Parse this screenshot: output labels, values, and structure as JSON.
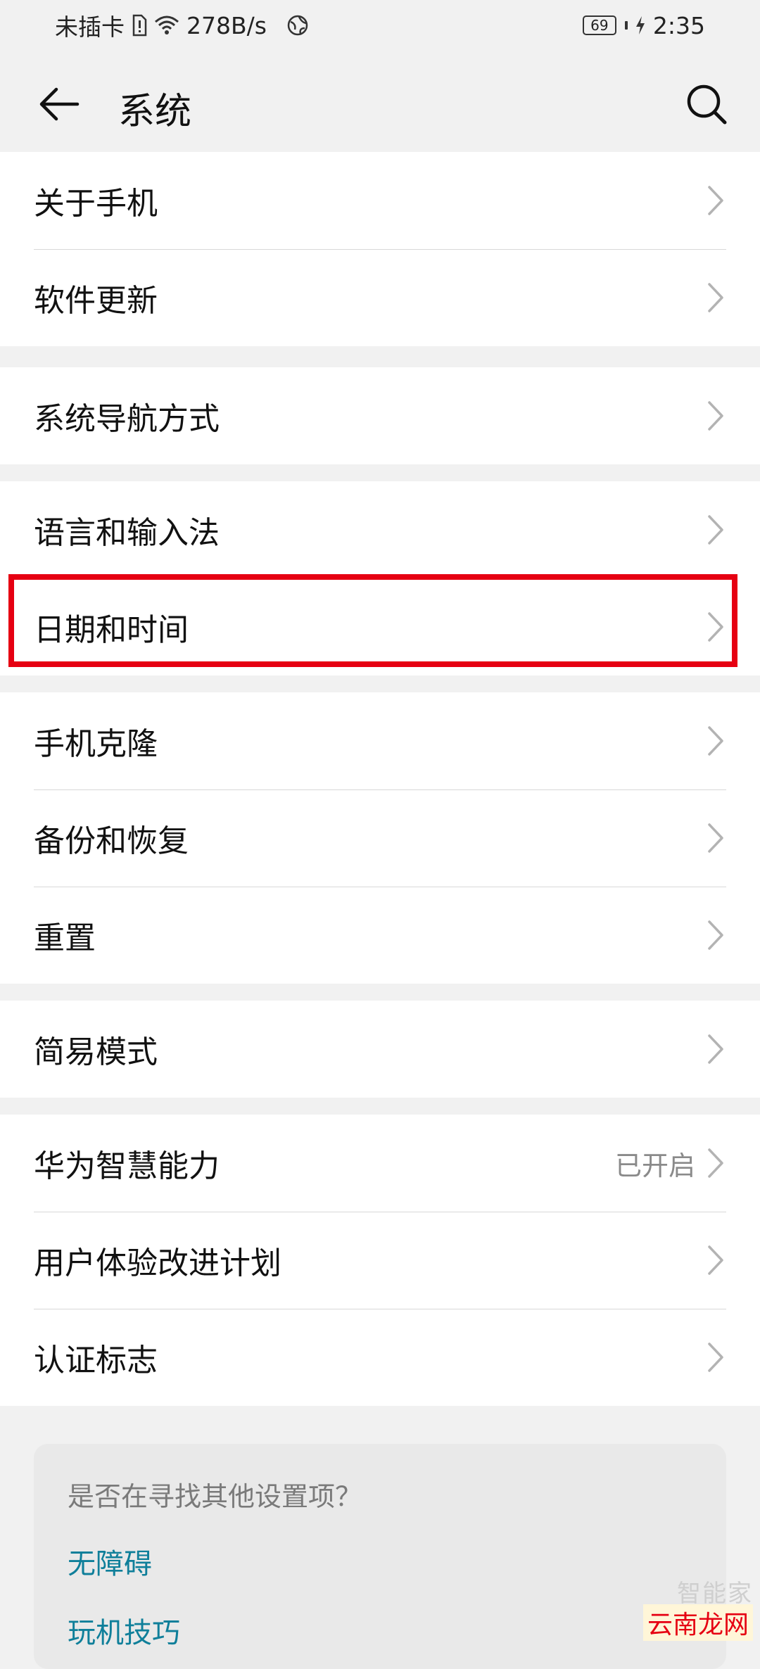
{
  "status_bar": {
    "carrier": "未插卡",
    "speed": "278B/s",
    "battery": "69",
    "time": "2:35"
  },
  "header": {
    "title": "系统"
  },
  "groups": [
    {
      "items": [
        {
          "label": "关于手机"
        },
        {
          "label": "软件更新"
        }
      ]
    },
    {
      "items": [
        {
          "label": "系统导航方式"
        }
      ]
    },
    {
      "items": [
        {
          "label": "语言和输入法"
        },
        {
          "label": "日期和时间"
        }
      ]
    },
    {
      "items": [
        {
          "label": "手机克隆"
        },
        {
          "label": "备份和恢复"
        },
        {
          "label": "重置"
        }
      ]
    },
    {
      "items": [
        {
          "label": "简易模式"
        }
      ]
    },
    {
      "items": [
        {
          "label": "华为智慧能力",
          "value": "已开启"
        },
        {
          "label": "用户体验改进计划"
        },
        {
          "label": "认证标志"
        }
      ]
    }
  ],
  "suggestions": {
    "title": "是否在寻找其他设置项？",
    "links": [
      "无障碍",
      "玩机技巧"
    ]
  },
  "watermark": {
    "line1": "智能家",
    "line2": "云南龙网"
  },
  "colors": {
    "highlight": "#e60012",
    "link": "#0f7f9a",
    "background": "#f1f1f1"
  }
}
